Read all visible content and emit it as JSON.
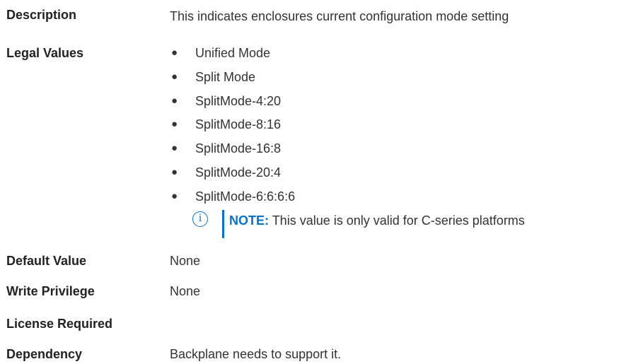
{
  "description": {
    "label": "Description",
    "value": "This indicates enclosures current configuration mode setting"
  },
  "legal_values": {
    "label": "Legal Values",
    "items": [
      "Unified Mode",
      "Split Mode",
      "SplitMode-4:20",
      "SplitMode-8:16",
      "SplitMode-16:8",
      "SplitMode-20:4",
      "SplitMode-6:6:6:6"
    ],
    "note": {
      "icon": "info-icon",
      "label": "NOTE:",
      "text": "This value is only valid for C-series platforms"
    }
  },
  "default_value": {
    "label": "Default Value",
    "value": "None"
  },
  "write_privilege": {
    "label": "Write Privilege",
    "value": "None"
  },
  "license_required": {
    "label": "License Required",
    "value": ""
  },
  "dependency": {
    "label": "Dependency",
    "value": "Backplane needs to support it."
  },
  "colors": {
    "note_accent": "#0672cb",
    "text": "#333333"
  }
}
